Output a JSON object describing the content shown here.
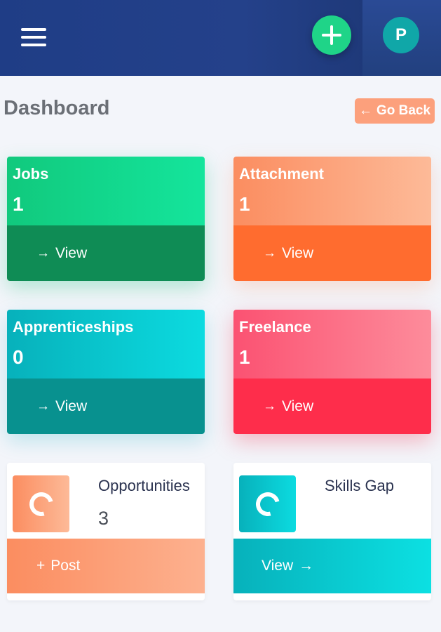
{
  "header": {
    "menu_icon": "hamburger-menu-icon",
    "add_icon": "plus-icon",
    "avatar_initial": "P",
    "colors": {
      "bar": "#1f3d86",
      "add_button": "#1fd488",
      "avatar": "#10a7a8"
    }
  },
  "page": {
    "title": "Dashboard",
    "back_arrow": "←",
    "back_label": "Go Back"
  },
  "cards": [
    {
      "title": "Jobs",
      "count": "1",
      "arrow": "→",
      "action": "View",
      "color": "#11c97d"
    },
    {
      "title": "Attachment",
      "count": "1",
      "arrow": "→",
      "action": "View",
      "color": "#fb8d60"
    },
    {
      "title": "Apprenticeships",
      "count": "0",
      "arrow": "→",
      "action": "View",
      "color": "#07b1bb"
    },
    {
      "title": "Freelance",
      "count": "1",
      "arrow": "→",
      "action": "View",
      "color": "#fb5272"
    }
  ],
  "info_cards": [
    {
      "title": "Opportunities",
      "count": "3",
      "action_icon": "+",
      "action": "Post",
      "icon": "donut-chart-icon"
    },
    {
      "title": "Skills Gap",
      "action": "View",
      "action_icon": "→",
      "icon": "donut-chart-icon"
    }
  ]
}
